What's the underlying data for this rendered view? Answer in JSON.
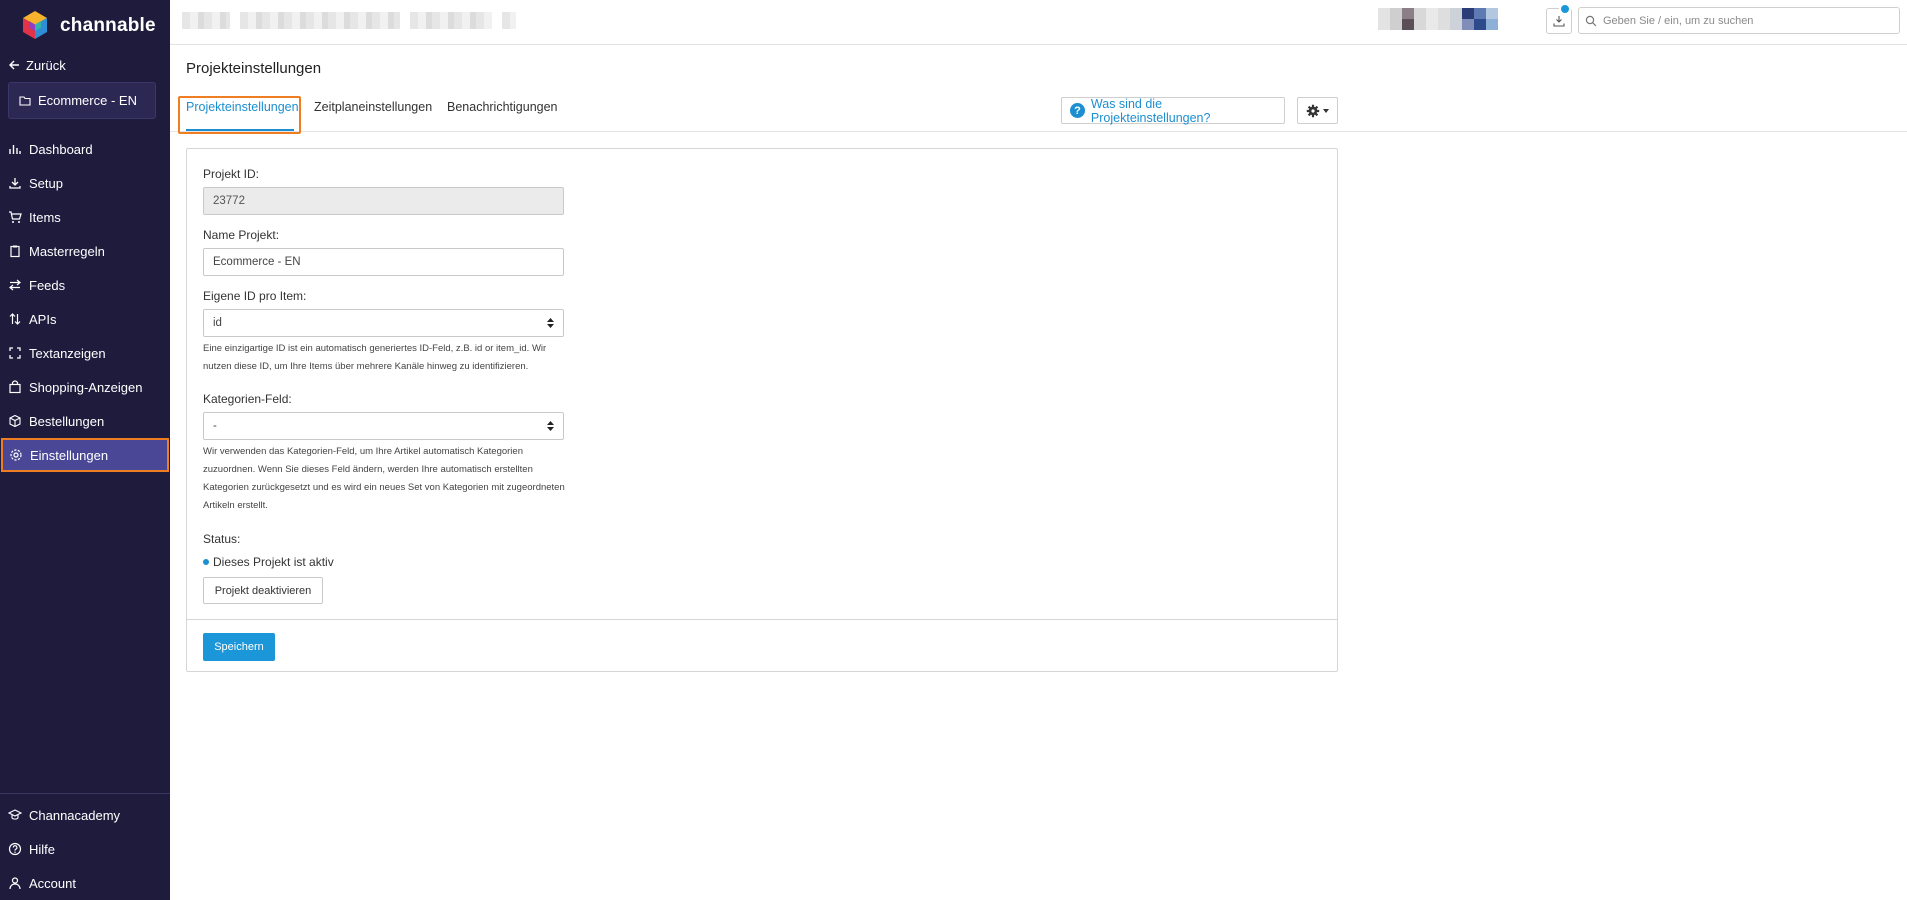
{
  "sidebar": {
    "brand": "channable",
    "back_label": "Zurück",
    "project_name": "Ecommerce - EN",
    "items": [
      {
        "label": "Dashboard"
      },
      {
        "label": "Setup"
      },
      {
        "label": "Items"
      },
      {
        "label": "Masterregeln"
      },
      {
        "label": "Feeds"
      },
      {
        "label": "APIs"
      },
      {
        "label": "Textanzeigen"
      },
      {
        "label": "Shopping-Anzeigen"
      },
      {
        "label": "Bestellungen"
      },
      {
        "label": "Einstellungen"
      }
    ],
    "active_item": "Einstellungen",
    "bottom_items": [
      {
        "label": "Channacademy"
      },
      {
        "label": "Hilfe"
      },
      {
        "label": "Account"
      }
    ]
  },
  "topbar": {
    "search_placeholder": "Geben Sie / ein, um zu suchen"
  },
  "page": {
    "title": "Projekteinstellungen",
    "tabs": [
      {
        "label": "Projekteinstellungen"
      },
      {
        "label": "Zeitplaneinstellungen"
      },
      {
        "label": "Benachrichtigungen"
      }
    ],
    "help_button": "Was sind die Projekteinstellungen?"
  },
  "form": {
    "project_id_label": "Projekt ID:",
    "project_id_value": "23772",
    "name_label": "Name Projekt:",
    "name_value": "Ecommerce - EN",
    "own_id_label": "Eigene ID pro Item:",
    "own_id_value": "id",
    "own_id_help": "Eine einzigartige ID ist ein automatisch generiertes ID-Feld, z.B. id or item_id. Wir nutzen diese ID, um Ihre Items über mehrere Kanäle hinweg zu identifizieren.",
    "category_label": "Kategorien-Feld:",
    "category_value": "-",
    "category_help": "Wir verwenden das Kategorien-Feld, um Ihre Artikel automatisch Kategorien zuzuordnen. Wenn Sie dieses Feld ändern, werden Ihre automatisch erstellten Kategorien zurückgesetzt und es wird ein neues Set von Kategorien mit zugeordneten Artikeln erstellt.",
    "status_label": "Status:",
    "status_text": "Dieses Projekt ist aktiv",
    "deactivate_button": "Projekt deaktivieren",
    "save_button": "Speichern"
  },
  "colors": {
    "sidebar_bg": "#1f1b3d",
    "active_nav_bg": "#4a4796",
    "highlight_outline": "#ef7d22",
    "accent_blue": "#1b96d8"
  }
}
